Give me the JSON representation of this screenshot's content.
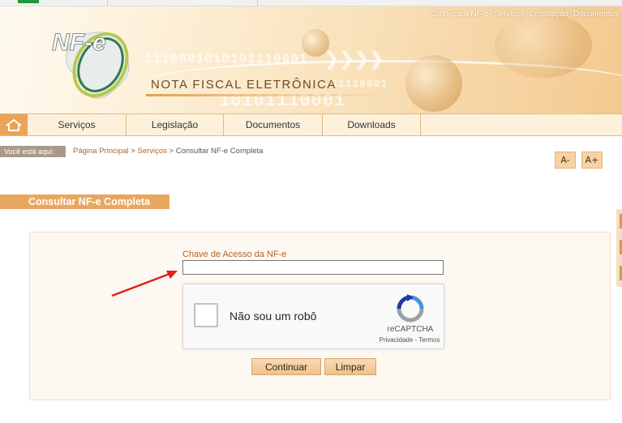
{
  "header": {
    "top_links": [
      "Conheça a NF-e",
      "Serviços",
      "Legislação",
      "Documentos"
    ],
    "logo_text": "NF-e",
    "brand_title": "NOTA FISCAL ELETRÔNICA",
    "binary_1": "1110001010101110001",
    "binary_2": "10101110001",
    "binary_3": "01110001"
  },
  "nav": {
    "home_icon": "home-icon",
    "items": [
      "Serviços",
      "Legislação",
      "Documentos",
      "Downloads"
    ]
  },
  "breadcrumb": {
    "label": "Você está aqui:",
    "link1": "Página Principal",
    "sep": " > ",
    "link2": "Serviços",
    "current": "Consultar NF-e Completa"
  },
  "font_controls": {
    "decrease": "A-",
    "increase": "A+"
  },
  "page_title": "Consultar NF-e Completa",
  "form": {
    "access_key_label": "Chave de Acesso da NF-e",
    "access_key_value": "",
    "captcha": {
      "label": "Não sou um robô",
      "brand": "reCAPTCHA",
      "privacy": "Privacidade",
      "terms_sep": " - ",
      "terms": "Termos"
    },
    "continue_label": "Continuar",
    "clear_label": "Limpar"
  },
  "colors": {
    "accent": "#e8a75f",
    "link": "#b0652a",
    "arrow": "#e0201b"
  }
}
